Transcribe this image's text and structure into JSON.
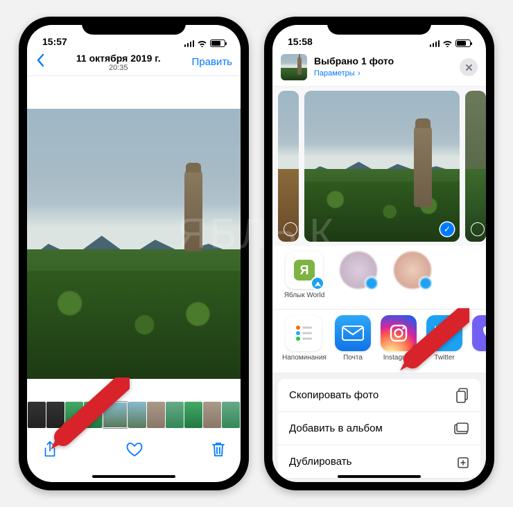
{
  "left": {
    "status_time": "15:57",
    "nav_date": "11 октября 2019 г.",
    "nav_time": "20:35",
    "edit_label": "Править"
  },
  "right": {
    "status_time": "15:58",
    "sheet_title": "Выбрано 1 фото",
    "sheet_options": "Параметры",
    "airdrop": [
      {
        "label": "Яблык World"
      },
      {
        "label": ""
      },
      {
        "label": ""
      }
    ],
    "apps": [
      {
        "label": "Напоминания"
      },
      {
        "label": "Почта"
      },
      {
        "label": "Instagram"
      },
      {
        "label": "Twitter"
      },
      {
        "label": ""
      }
    ],
    "actions": [
      {
        "label": "Скопировать фото"
      },
      {
        "label": "Добавить в альбом"
      },
      {
        "label": "Дублировать"
      }
    ]
  },
  "watermark": "ЯБЛЫК"
}
